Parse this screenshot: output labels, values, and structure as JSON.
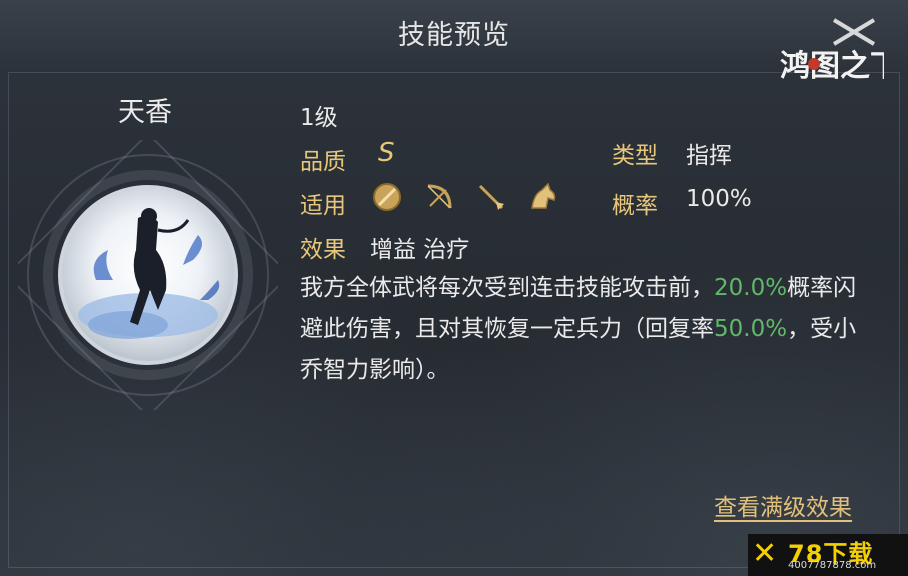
{
  "header": {
    "title": "技能预览",
    "logo_text": "鸿图之下"
  },
  "hero": {
    "name": "天香"
  },
  "skill": {
    "level": "1级",
    "quality_label": "品质",
    "quality_value": "S",
    "type_label": "类型",
    "type_value": "指挥",
    "apply_label": "适用",
    "apply_units": [
      "shield-icon",
      "bow-icon",
      "spear-icon",
      "horse-icon"
    ],
    "prob_label": "概率",
    "prob_value": "100%",
    "effect_label": "效果",
    "effect_values": "增益 治疗",
    "desc_part1": "我方全体武将每次受到连击技能攻击前，",
    "desc_value1": "20.0%",
    "desc_part2": "概率闪避此伤害，且对其恢复一定兵力（回复率",
    "desc_value2": "50.0%",
    "desc_part3": "，受小乔智力影响）。"
  },
  "actions": {
    "view_max_label": "查看满级效果"
  },
  "watermark": {
    "main": "78下载",
    "sub": "4007787878.com"
  },
  "colors": {
    "label": "#e8c77a",
    "highlight": "#62b86a",
    "text": "#eaeaea"
  }
}
